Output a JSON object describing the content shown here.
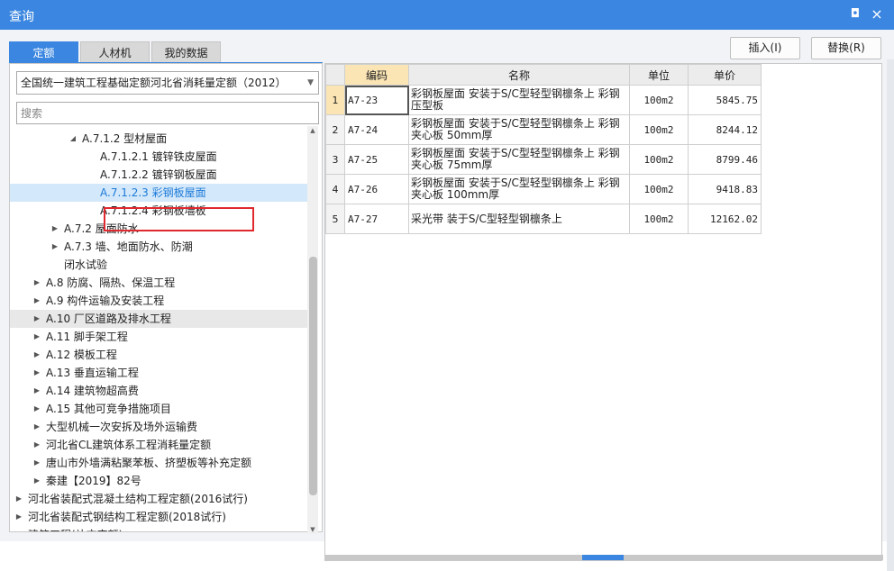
{
  "window": {
    "title": "查询",
    "restore_glyph": "◘",
    "close_glyph": "×"
  },
  "tabs": [
    {
      "label": "定额",
      "active": true
    },
    {
      "label": "人材机",
      "active": false
    },
    {
      "label": "我的数据",
      "active": false
    }
  ],
  "actions": {
    "insert_label": "插入(I)",
    "replace_label": "替换(R)"
  },
  "left": {
    "library_select": "全国统一建筑工程基础定额河北省消耗量定额（2012）",
    "search_placeholder": "搜索",
    "tree": [
      {
        "label": "A.7.1.2 型材屋面",
        "arrow": "◢",
        "level": 3,
        "state": "expanded"
      },
      {
        "label": "A.7.1.2.1 镀锌铁皮屋面",
        "arrow": "",
        "level": 4,
        "state": ""
      },
      {
        "label": "A.7.1.2.2 镀锌钢板屋面",
        "arrow": "",
        "level": 4,
        "state": ""
      },
      {
        "label": "A.7.1.2.3 彩钢板屋面",
        "arrow": "",
        "level": 4,
        "state": "selected"
      },
      {
        "label": "A.7.1.2.4 彩钢板墙板",
        "arrow": "",
        "level": 4,
        "state": ""
      },
      {
        "label": "A.7.2 屋面防水",
        "arrow": "▶",
        "level": 2,
        "state": ""
      },
      {
        "label": "A.7.3 墙、地面防水、防潮",
        "arrow": "▶",
        "level": 2,
        "state": ""
      },
      {
        "label": "闭水试验",
        "arrow": "",
        "level": 2,
        "state": ""
      },
      {
        "label": "A.8 防腐、隔热、保温工程",
        "arrow": "▶",
        "level": 1,
        "state": ""
      },
      {
        "label": "A.9 构件运输及安装工程",
        "arrow": "▶",
        "level": 1,
        "state": ""
      },
      {
        "label": "A.10 厂区道路及排水工程",
        "arrow": "▶",
        "level": 1,
        "state": "hover"
      },
      {
        "label": "A.11 脚手架工程",
        "arrow": "▶",
        "level": 1,
        "state": ""
      },
      {
        "label": "A.12 模板工程",
        "arrow": "▶",
        "level": 1,
        "state": ""
      },
      {
        "label": "A.13 垂直运输工程",
        "arrow": "▶",
        "level": 1,
        "state": ""
      },
      {
        "label": "A.14 建筑物超高费",
        "arrow": "▶",
        "level": 1,
        "state": ""
      },
      {
        "label": "A.15 其他可竞争措施项目",
        "arrow": "▶",
        "level": 1,
        "state": ""
      },
      {
        "label": "大型机械一次安拆及场外运输费",
        "arrow": "▶",
        "level": 1,
        "state": ""
      },
      {
        "label": "河北省CL建筑体系工程消耗量定额",
        "arrow": "▶",
        "level": 1,
        "state": ""
      },
      {
        "label": "唐山市外墙满粘聚苯板、挤塑板等补充定额",
        "arrow": "▶",
        "level": 1,
        "state": ""
      },
      {
        "label": "秦建【2019】82号",
        "arrow": "▶",
        "level": 1,
        "state": ""
      },
      {
        "label": "河北省装配式混凝土结构工程定额(2016试行)",
        "arrow": "▶",
        "level": 0,
        "state": ""
      },
      {
        "label": "河北省装配式钢结构工程定额(2018试行)",
        "arrow": "▶",
        "level": 0,
        "state": ""
      },
      {
        "label": "建筑工程(补充定额)",
        "arrow": "▶",
        "level": 0,
        "state": ""
      }
    ]
  },
  "grid": {
    "columns": [
      "",
      "编码",
      "名称",
      "单位",
      "单价"
    ],
    "rows": [
      {
        "num": "1",
        "code": "A7-23",
        "name": "彩钢板屋面 安装于S/C型轻型钢檩条上 彩钢压型板",
        "unit": "100m2",
        "price": "5845.75"
      },
      {
        "num": "2",
        "code": "A7-24",
        "name": "彩钢板屋面 安装于S/C型轻型钢檩条上 彩钢夹心板 50mm厚",
        "unit": "100m2",
        "price": "8244.12"
      },
      {
        "num": "3",
        "code": "A7-25",
        "name": "彩钢板屋面 安装于S/C型轻型钢檩条上 彩钢夹心板 75mm厚",
        "unit": "100m2",
        "price": "8799.46"
      },
      {
        "num": "4",
        "code": "A7-26",
        "name": "彩钢板屋面 安装于S/C型轻型钢檩条上 彩钢夹心板 100mm厚",
        "unit": "100m2",
        "price": "9418.83"
      },
      {
        "num": "5",
        "code": "A7-27",
        "name": "采光带 装于S/C型轻型钢檩条上",
        "unit": "100m2",
        "price": "12162.02"
      }
    ]
  },
  "colors": {
    "accent": "#3a86e0",
    "selected_text": "#1d7ad8",
    "highlight": "#e0292f",
    "active_header": "#fbe5b5"
  }
}
